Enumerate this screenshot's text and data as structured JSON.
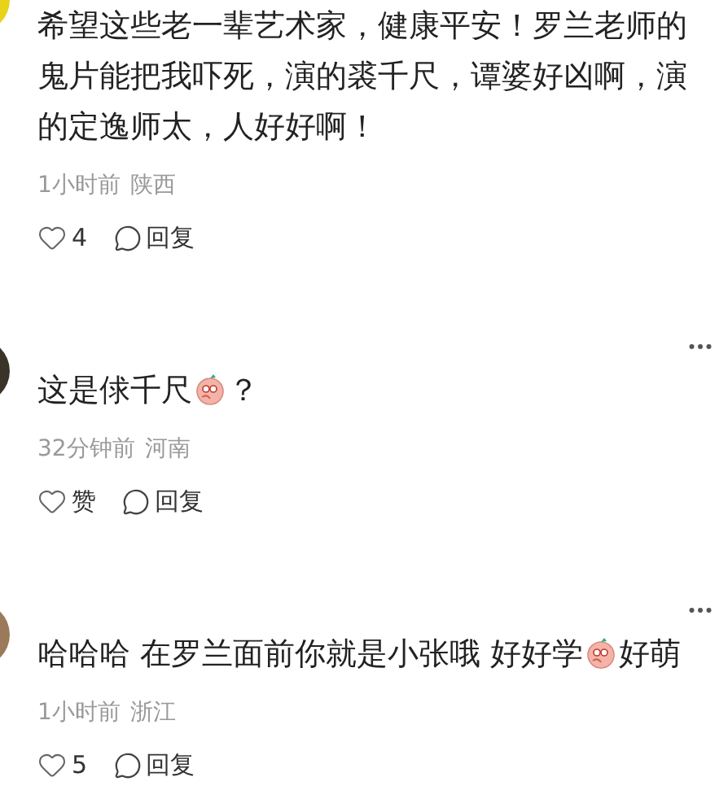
{
  "comments": [
    {
      "has_menu": false,
      "content": [
        {
          "kind": "text",
          "text": "希望这些老一辈艺术家，健康平安！罗兰老师的鬼片能把我吓死，演的裘千尺，谭婆好凶啊，演的定逸师太，人好好啊！"
        }
      ],
      "time": "1小时前",
      "location": "陕西",
      "likes": "4",
      "reply": "回复"
    },
    {
      "has_menu": true,
      "content": [
        {
          "kind": "text",
          "text": "这是俅千尺"
        },
        {
          "kind": "emoji"
        },
        {
          "kind": "text",
          "text": "？"
        }
      ],
      "time": "32分钟前",
      "location": "河南",
      "likes": "赞",
      "reply": "回复"
    },
    {
      "has_menu": true,
      "content": [
        {
          "kind": "text",
          "text": "哈哈哈 在罗兰面前你就是小张哦 好好学"
        },
        {
          "kind": "emoji"
        },
        {
          "kind": "text",
          "text": "好萌"
        }
      ],
      "time": "1小时前",
      "location": "浙江",
      "likes": "5",
      "reply": "回复"
    }
  ]
}
